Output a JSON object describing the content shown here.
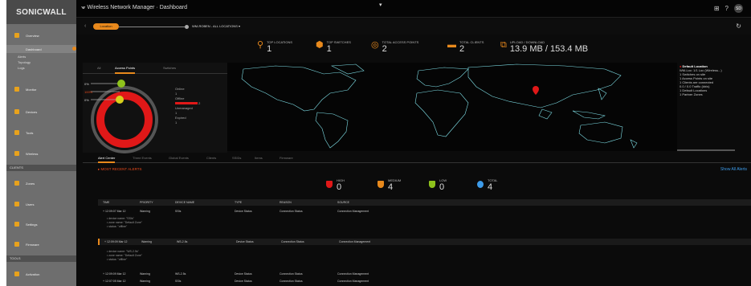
{
  "sidebar": {
    "logo": "SONICWALL",
    "items": [
      {
        "label": "Overview",
        "selected": false
      },
      {
        "label": "Dashboard",
        "selected": true
      },
      {
        "label": "Monitor",
        "selected": false
      },
      {
        "label": "Devices",
        "selected": false
      },
      {
        "label": "Tools",
        "selected": false
      },
      {
        "label": "Wireless",
        "selected": false
      },
      {
        "label": "Zones",
        "selected": false
      },
      {
        "label": "Users",
        "selected": false
      },
      {
        "label": "Settings",
        "selected": false
      },
      {
        "label": "Firmware",
        "selected": false
      },
      {
        "label": "Activation",
        "selected": false
      }
    ],
    "subitems": [
      "Dashboard",
      "Alerts",
      "Topology",
      "Logs"
    ],
    "sections": [
      "CLIENTS",
      "TOOLS"
    ]
  },
  "topbar": {
    "crumb": "Wireless Network Manager  ·  Dashboard",
    "avatar": "SD"
  },
  "filter": {
    "pill": "Location",
    "location": "WM-ROBEN - ALL LOCATIONS ▾"
  },
  "stats": [
    {
      "label": "TOP LOCATIONS",
      "value": "1"
    },
    {
      "label": "TOP SWITCHES",
      "value": "1"
    },
    {
      "label": "TOTAL ACCESS POINTS",
      "value": "2"
    },
    {
      "label": "TOTAL CLIENTS",
      "value": "2"
    },
    {
      "label": "UPLOAD / DOWNLOAD",
      "value": "13.9 MB / 153.4 MB"
    }
  ],
  "devices_panel": {
    "tabs": [
      "All",
      "Access Points",
      "Switches"
    ],
    "active_tab": "Access Points",
    "ring": {
      "online_label": "0%",
      "offline_label": "100%",
      "managed_label": "0%"
    },
    "legend": [
      "Online",
      "1",
      "Offline",
      "2",
      "Unmanaged",
      "1",
      "Expired",
      "1"
    ]
  },
  "map": {
    "location_title": "Default Location",
    "location_lines": [
      "WM-Loc: 1/1 Loc (Wireless...)",
      "1 Switches on site",
      "1 Access Points on site",
      "1 Clients are connected",
      "0.0 / 0.0 Traffic (kb/s)",
      "1 Default Locations",
      "1 Partner Zones"
    ]
  },
  "alert_tabs": [
    "Alert Center",
    "Three Events",
    "Global Events",
    "Clients",
    "SSIDs",
    "Items",
    "Firmware"
  ],
  "most_recent": "MOST RECENT ALERTS",
  "show_all": "Show All Alerts",
  "severity": [
    {
      "label": "HIGH",
      "value": "0",
      "color": "#e01818"
    },
    {
      "label": "MEDIUM",
      "value": "4",
      "color": "#e8891c"
    },
    {
      "label": "LOW",
      "value": "0",
      "color": "#8ec21c"
    },
    {
      "label": "TOTAL",
      "value": "4",
      "color": "#3d9be9"
    }
  ],
  "table": {
    "headers": [
      "TIME",
      "PRIORITY",
      "DEVICE NAME",
      "TYPE",
      "REASON",
      "SOURCE"
    ],
    "rows": [
      {
        "cells": [
          "+ 12:09:07 Mar 12",
          "Warning",
          "SSIs",
          "Device Status",
          "Connection Status",
          "Connection Management"
        ],
        "detail": [
          "• device name: \"SSIs\"",
          "• zone name: \"Default Zone\"",
          "• status: \"offline\""
        ]
      },
      {
        "cells": [
          "+ 12:09:09 Mar 12",
          "Warning",
          "WS-2.5s",
          "Device Status",
          "Connection Status",
          "Connection Management"
        ],
        "detail": [
          "• device name: \"WS-2.5s\"",
          "• zone name: \"Default Zone\"",
          "• status: \"offline\""
        ]
      },
      {
        "cells": [
          "+ 12:09:09 Mar 12",
          "Warning",
          "WS-2.5s",
          "Device Status",
          "Connection Status",
          "Connection Management"
        ],
        "detail": []
      },
      {
        "cells": [
          "+ 12:07:05 Mar 12",
          "Warning",
          "SSIs",
          "Device Status",
          "Connection Status",
          "Connection Management"
        ],
        "detail": []
      }
    ]
  },
  "colors": {
    "accent": "#e8891c",
    "alert_red": "#e01818",
    "map_line": "#7fe0e8",
    "link_blue": "#3d9be9"
  }
}
